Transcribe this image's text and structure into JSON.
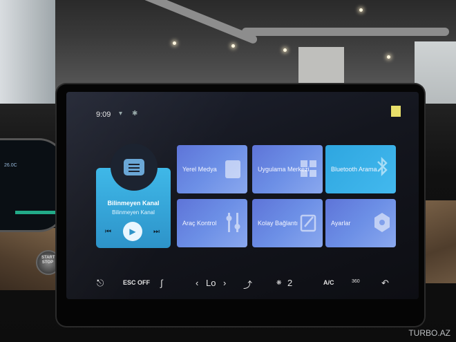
{
  "status": {
    "time": "9:09"
  },
  "media": {
    "title": "Bilinmeyen Kanal",
    "subtitle": "Bilinmeyen Kanal"
  },
  "tiles": [
    {
      "label": "Yerel Medya",
      "icon": "media-icon"
    },
    {
      "label": "Uygulama Merkezi",
      "icon": "apps-grid-icon"
    },
    {
      "label": "Bluetooth Arama",
      "icon": "bluetooth-phone-icon"
    },
    {
      "label": "Araç Kontrol",
      "icon": "sliders-icon"
    },
    {
      "label": "Kolay Bağlantı",
      "icon": "link-icon"
    },
    {
      "label": "Ayarlar",
      "icon": "hexagon-settings-icon"
    }
  ],
  "bottom_bar": {
    "esc_off": "ESC OFF",
    "temp_mode": "Lo",
    "fan_level": "2",
    "ac": "A/C",
    "recirc": "360"
  },
  "watermark": "TURBO.AZ"
}
